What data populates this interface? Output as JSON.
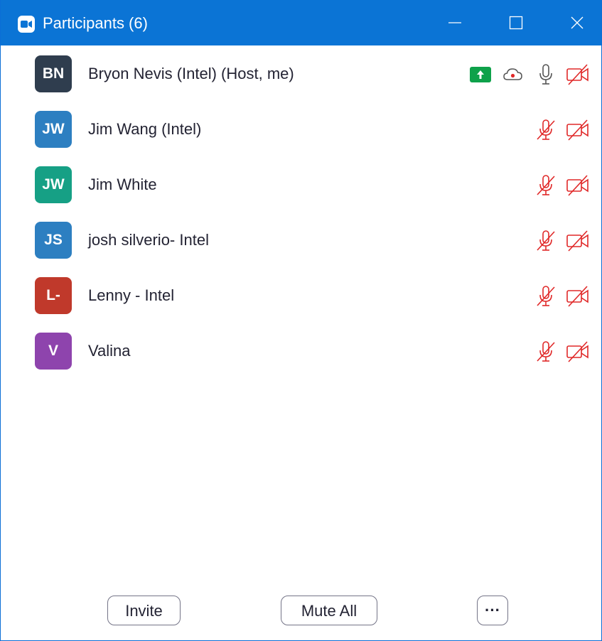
{
  "titlebar": {
    "title": "Participants (6)",
    "app_icon": "zoom-camera-icon",
    "controls": [
      "minimize-icon",
      "maximize-icon",
      "close-icon"
    ]
  },
  "participants": [
    {
      "initials": "BN",
      "name": "Bryon Nevis (Intel) (Host, me)",
      "avatar_color": "#2f3d4e",
      "sharing": true,
      "recording": true,
      "mic": "on",
      "video": "off"
    },
    {
      "initials": "JW",
      "name": "Jim Wang (Intel)",
      "avatar_color": "#2d7fc1",
      "mic": "muted",
      "video": "off"
    },
    {
      "initials": "JW",
      "name": "Jim White",
      "avatar_color": "#16a085",
      "mic": "muted",
      "video": "off"
    },
    {
      "initials": "JS",
      "name": "josh silverio- Intel",
      "avatar_color": "#2d7fc1",
      "mic": "muted",
      "video": "off"
    },
    {
      "initials": "L-",
      "name": "Lenny - Intel",
      "avatar_color": "#c0392b",
      "mic": "muted",
      "video": "off"
    },
    {
      "initials": "V",
      "name": "Valina",
      "avatar_color": "#8e44ad",
      "mic": "muted",
      "video": "off"
    }
  ],
  "colors": {
    "titlebar": "#0b74d5",
    "muted_red": "#e02828",
    "share_green": "#0ea14a"
  },
  "footer": {
    "invite_label": "Invite",
    "mute_all_label": "Mute All",
    "more_label": "···"
  }
}
